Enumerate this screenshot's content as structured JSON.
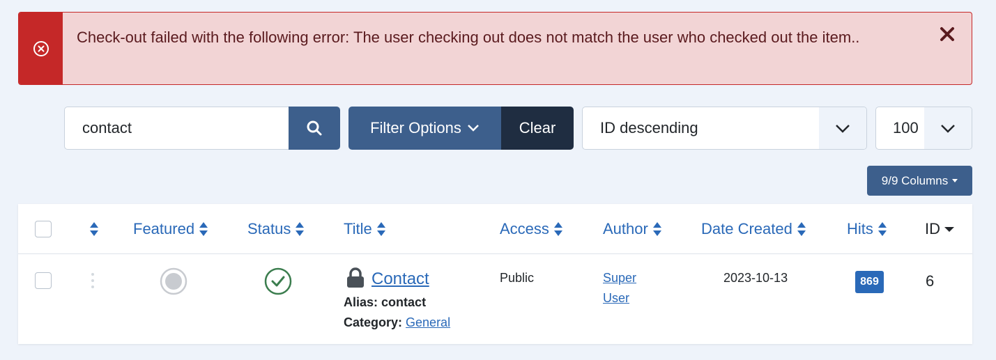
{
  "alert": {
    "message": "Check-out failed with the following error: The user checking out does not match the user who checked out the item.."
  },
  "search": {
    "value": "contact",
    "placeholder": "Search"
  },
  "filters": {
    "filter_options_label": "Filter Options",
    "clear_label": "Clear"
  },
  "ordering": {
    "selected": "ID descending"
  },
  "limit": {
    "selected": "100"
  },
  "columns_button": {
    "label": "9/9 Columns"
  },
  "table": {
    "headers": {
      "featured": "Featured",
      "status": "Status",
      "title": "Title",
      "access": "Access",
      "author": "Author",
      "date_created": "Date Created",
      "hits": "Hits",
      "id": "ID"
    },
    "rows": [
      {
        "title": "Contact",
        "alias_label": "Alias:",
        "alias": "contact",
        "category_label": "Category:",
        "category": "General",
        "access": "Public",
        "author": "Super User",
        "date_created": "2023-10-13",
        "hits": "869",
        "id": "6",
        "featured_icon": "featured-off-circle",
        "status_icon": "published-check-circle",
        "checked_out_icon": "lock"
      }
    ]
  },
  "colors": {
    "danger": "#c52828",
    "alert_bg": "#f2d4d5",
    "primary": "#3d5f8c",
    "dark": "#1f2d41",
    "link": "#2a69b8",
    "success": "#3b7d4e"
  }
}
